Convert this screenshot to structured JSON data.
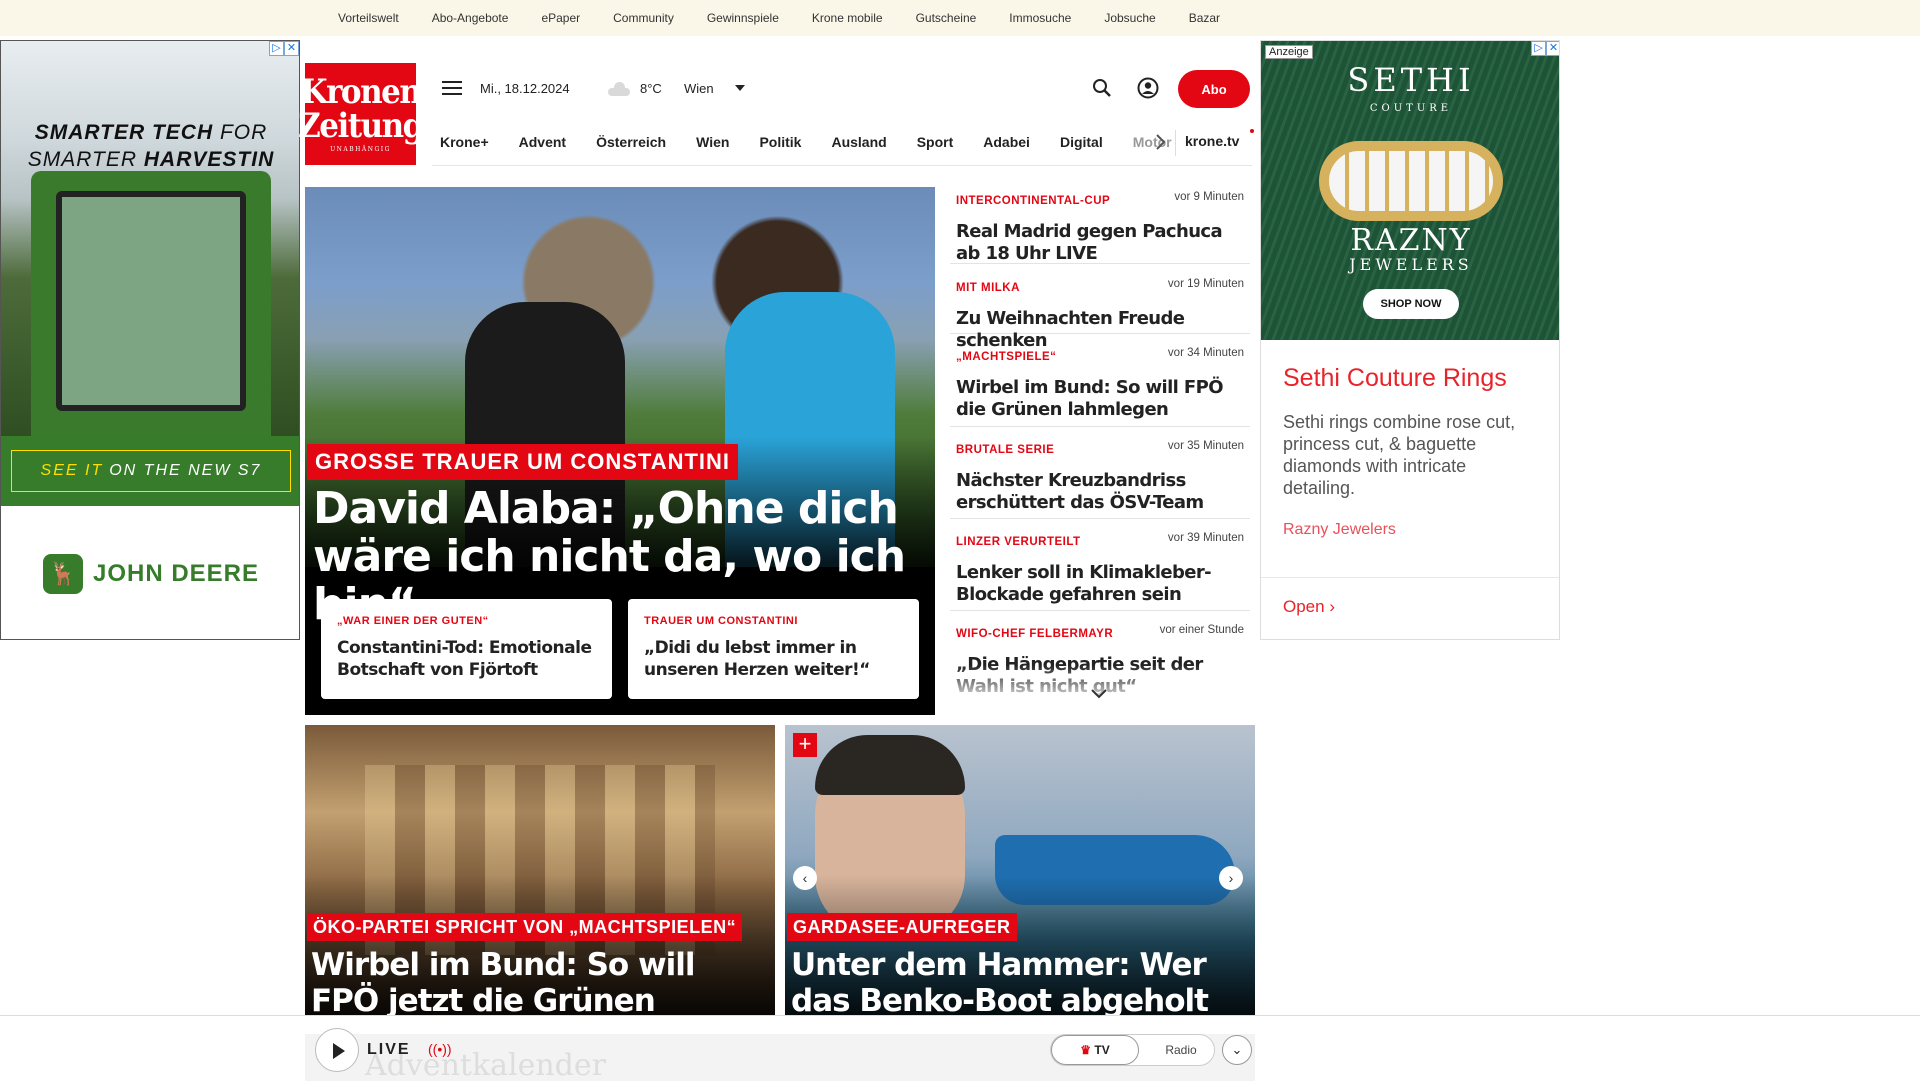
{
  "topbar": {
    "links": [
      "Vorteilswelt",
      "Abo-Angebote",
      "ePaper",
      "Community",
      "Gewinnspiele",
      "Krone mobile",
      "Gutscheine",
      "Immosuche",
      "Jobsuche",
      "Bazar"
    ]
  },
  "ad_left": {
    "headline_1a": "SMARTER TECH",
    "headline_1b": " FOR",
    "headline_2a": "SMARTER ",
    "headline_2b": "HARVESTIN",
    "cta_a": "SEE IT",
    "cta_b": "ON THE NEW S7",
    "brand": "JOHN DEERE",
    "colors": {
      "green": "#367c2b",
      "yellow": "#ffde00"
    }
  },
  "header": {
    "logo_line1": "Kronen",
    "logo_line2": "Zeitung",
    "logo_line3": "UNABHÄNGIG",
    "date": "Mi., 18.12.2024",
    "temperature": "8°C",
    "city": "Wien",
    "abo_label": "Abo",
    "accent": "#e30613"
  },
  "nav": {
    "items": [
      "Krone+",
      "Advent",
      "Österreich",
      "Wien",
      "Politik",
      "Ausland",
      "Sport",
      "Adabei",
      "Digital",
      "Motor"
    ],
    "tv": "krone.tv"
  },
  "hero": {
    "kicker": "GROSSE TRAUER UM CONSTANTINI",
    "title": "David Alaba: „Ohne dich wäre ich nicht da, wo ich bin“",
    "subs": [
      {
        "kicker": "„WAR EINER DER GUTEN“",
        "title": "Constantini-Tod: Emotionale Botschaft von Fjörtoft"
      },
      {
        "kicker": "TRAUER UM CONSTANTINI",
        "title": "„Didi du lebst immer in unseren Herzen weiter!“"
      }
    ]
  },
  "ticker": [
    {
      "kicker": "INTERCONTINENTAL-CUP",
      "time": "vor 9 Minuten",
      "title": "Real Madrid gegen Pachuca ab 18 Uhr LIVE"
    },
    {
      "kicker": "MIT MILKA",
      "time": "vor 19 Minuten",
      "title": "Zu Weihnachten Freude schenken"
    },
    {
      "kicker": "„MACHTSPIELE“",
      "time": "vor 34 Minuten",
      "title": "Wirbel im Bund: So will FPÖ die Grünen lahmlegen"
    },
    {
      "kicker": "BRUTALE SERIE",
      "time": "vor 35 Minuten",
      "title": "Nächster Kreuzbandriss erschüttert das ÖSV-Team"
    },
    {
      "kicker": "LINZER VERURTEILT",
      "time": "vor 39 Minuten",
      "title": "Lenker soll in Klimakleber-Blockade gefahren sein"
    },
    {
      "kicker": "WIFO-CHEF FELBERMAYR",
      "time": "vor einer Stunde",
      "title": "„Die Hängepartie seit der Wahl ist nicht gut“"
    }
  ],
  "ad_right": {
    "anzeige": "Anzeige",
    "sethi": "SETHI",
    "couture": "COUTURE",
    "razny": "RAZNY",
    "jewelers": "JEWELERS",
    "shop": "SHOP NOW",
    "heading": "Sethi Couture Rings",
    "description": "Sethi rings combine rose cut, princess cut, & baguette diamonds with intricate detailing.",
    "advertiser": "Razny Jewelers",
    "open": "Open"
  },
  "cards": [
    {
      "kicker": "ÖKO-PARTEI SPRICHT VON „MACHTSPIELEN“",
      "title": "Wirbel im Bund: So will FPÖ jetzt die Grünen lahmlegen"
    },
    {
      "kicker": "GARDASEE-AUFREGER",
      "title": "Unter dem Hammer: Wer das Benko-Boot abgeholt hat"
    }
  ],
  "player": {
    "live": "LIVE",
    "tv": "TV",
    "radio": "Radio",
    "behind_text": "Adventkalender"
  }
}
